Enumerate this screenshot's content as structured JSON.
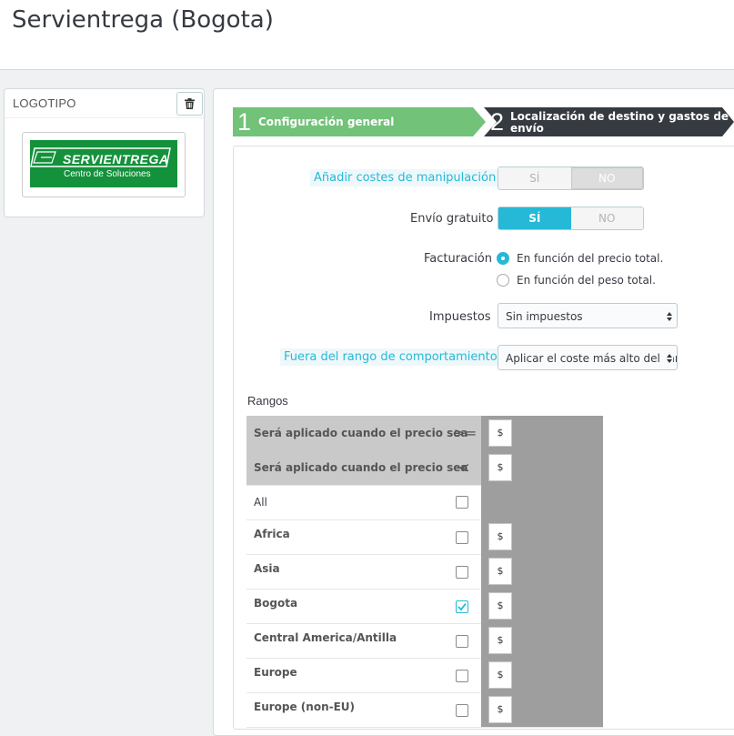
{
  "header": {
    "title": "Servientrega (Bogota)"
  },
  "logo_panel": {
    "heading": "LOGOTIPO",
    "logo_text_main": "SERVIENTREGA",
    "logo_text_sub": "Centro de Soluciones",
    "brand_color": "#14913b"
  },
  "steps": [
    {
      "number": "1",
      "label": "Configuración general",
      "color": "#72c279"
    },
    {
      "number": "2",
      "label_line1": "Localización de destino y gastos de",
      "label_line2": "envío",
      "color": "#363a41"
    }
  ],
  "form": {
    "handling_costs": {
      "label": "Añadir costes de manipulación",
      "yes": "SÍ",
      "no": "NO",
      "selected": "no"
    },
    "free_shipping": {
      "label": "Envío gratuito",
      "yes": "SÍ",
      "no": "NO",
      "selected": "yes"
    },
    "billing": {
      "label": "Facturación",
      "options": [
        "En función del precio total.",
        "En función del peso total."
      ],
      "selected_index": 0
    },
    "taxes": {
      "label": "Impuestos",
      "value": "Sin impuestos"
    },
    "out_of_range": {
      "label": "Fuera del rango de comportamiento",
      "value": "Aplicar el coste más alto del ran"
    }
  },
  "ranges": {
    "label": "Rangos",
    "header_rows": [
      {
        "label": "Será aplicado cuando el precio sea",
        "operator": ">=",
        "currency": "$"
      },
      {
        "label": "Será aplicado cuando el precio sea",
        "operator": "<",
        "currency": "$"
      }
    ],
    "all_label": "All",
    "zones": [
      {
        "name": "Africa",
        "checked": false,
        "currency": "$"
      },
      {
        "name": "Asia",
        "checked": false,
        "currency": "$"
      },
      {
        "name": "Bogota",
        "checked": true,
        "currency": "$"
      },
      {
        "name": "Central America/Antilla",
        "checked": false,
        "currency": "$"
      },
      {
        "name": "Europe",
        "checked": false,
        "currency": "$"
      },
      {
        "name": "Europe (non-EU)",
        "checked": false,
        "currency": "$"
      }
    ]
  },
  "colors": {
    "accent": "#25b9d7",
    "step_active": "#72c279",
    "step_next": "#363a41"
  }
}
